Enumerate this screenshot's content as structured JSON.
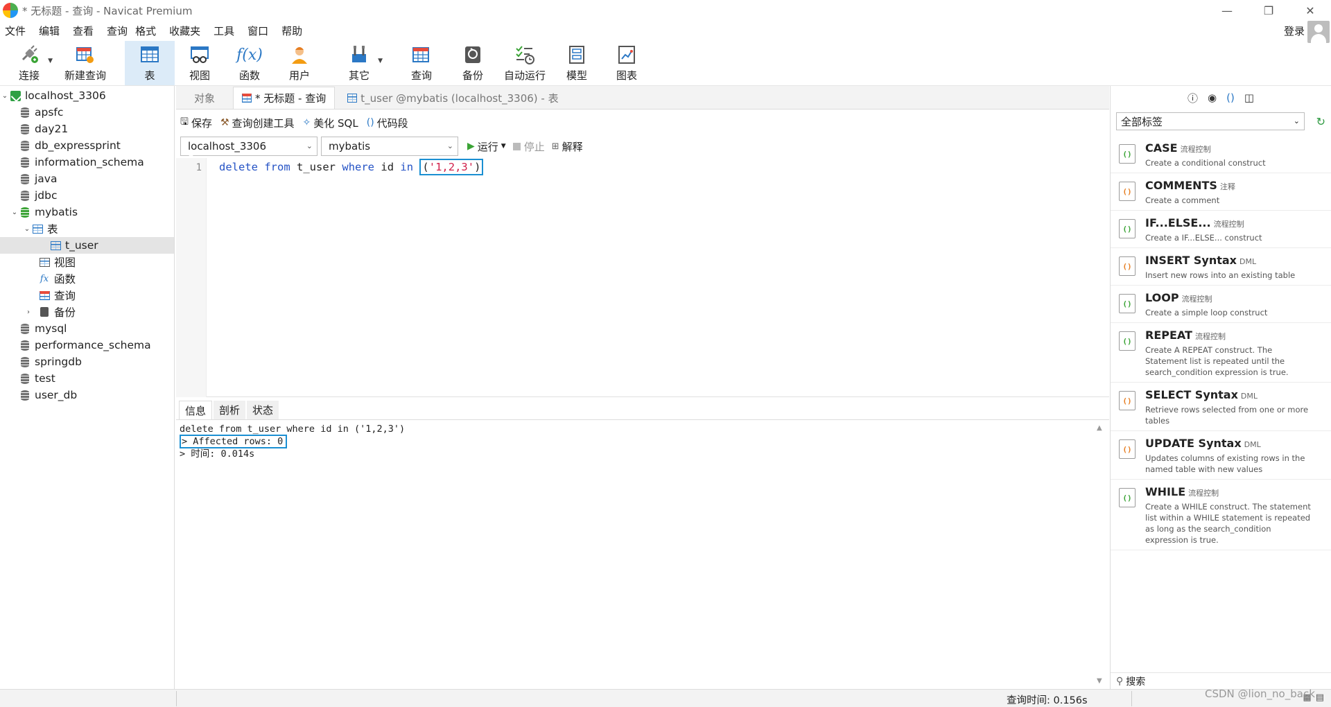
{
  "window": {
    "title": "* 无标题 - 查询 - Navicat Premium",
    "controls": {
      "minimize": "—",
      "restore": "❐",
      "close": "✕"
    }
  },
  "menu": [
    "文件",
    "编辑",
    "查看",
    "查询",
    "格式",
    "收藏夹",
    "工具",
    "窗口",
    "帮助"
  ],
  "account": {
    "login_label": "登录"
  },
  "toolbar": {
    "connect": "连接",
    "new_query": "新建查询",
    "table": "表",
    "view": "视图",
    "function": "函数",
    "user": "用户",
    "other": "其它",
    "query": "查询",
    "backup": "备份",
    "auto_run": "自动运行",
    "model": "模型",
    "chart": "图表"
  },
  "tree": {
    "connection": "localhost_3306",
    "databases_before": [
      "apsfc",
      "day21",
      "db_expressprint",
      "information_schema",
      "java",
      "jdbc"
    ],
    "open_db": "mybatis",
    "children": {
      "tables": "表",
      "table_item": "t_user",
      "views": "视图",
      "functions": "函数",
      "queries": "查询",
      "backups": "备份"
    },
    "databases_after": [
      "mysql",
      "performance_schema",
      "springdb",
      "test",
      "user_db"
    ]
  },
  "tabs": {
    "objects": "对象",
    "query_tab": "* 无标题 - 查询",
    "table_tab": "t_user @mybatis (localhost_3306) - 表"
  },
  "editor_toolbar": {
    "save": "保存",
    "query_builder": "查询创建工具",
    "beautify": "美化 SQL",
    "snippet": "代码段"
  },
  "connbar": {
    "connection": "localhost_3306",
    "database": "mybatis",
    "run": "运行",
    "stop": "停止",
    "explain": "解释"
  },
  "editor": {
    "line_number": "1",
    "kw_delete": "delete",
    "kw_from": "from",
    "table": "t_user",
    "kw_where": "where",
    "column": "id",
    "kw_in": "in",
    "paren_open": "(",
    "value": "'1,2,3'",
    "paren_close": ")"
  },
  "results": {
    "tabs": [
      "信息",
      "剖析",
      "状态"
    ],
    "lines": {
      "sql": "delete from t_user where id in ('1,2,3')",
      "affected": "> Affected rows: 0",
      "time": "> 时间: 0.014s"
    }
  },
  "right_panel": {
    "tag_filter": "全部标签",
    "search_placeholder": "搜索",
    "snippets": [
      {
        "title": "CASE",
        "tag": "流程控制",
        "desc": "Create a conditional construct",
        "icon": "green"
      },
      {
        "title": "COMMENTS",
        "tag": "注释",
        "desc": "Create a comment",
        "icon": "orange"
      },
      {
        "title": "IF...ELSE...",
        "tag": "流程控制",
        "desc": "Create a IF...ELSE... construct",
        "icon": "green"
      },
      {
        "title": "INSERT Syntax",
        "tag": "DML",
        "desc": "Insert new rows into an existing table",
        "icon": "orange"
      },
      {
        "title": "LOOP",
        "tag": "流程控制",
        "desc": "Create a simple loop construct",
        "icon": "green"
      },
      {
        "title": "REPEAT",
        "tag": "流程控制",
        "desc": "Create A REPEAT construct. The Statement list is repeated until the search_condition expression is true.",
        "icon": "green"
      },
      {
        "title": "SELECT Syntax",
        "tag": "DML",
        "desc": "Retrieve rows selected from one or more tables",
        "icon": "orange"
      },
      {
        "title": "UPDATE Syntax",
        "tag": "DML",
        "desc": "Updates columns of existing rows in the named table with new values",
        "icon": "orange"
      },
      {
        "title": "WHILE",
        "tag": "流程控制",
        "desc": "Create a WHILE construct. The statement list within a WHILE statement is repeated as long as the search_condition expression is true.",
        "icon": "green"
      }
    ]
  },
  "status": {
    "query_time": "查询时间: 0.156s",
    "watermark": "CSDN @lion_no_back"
  }
}
